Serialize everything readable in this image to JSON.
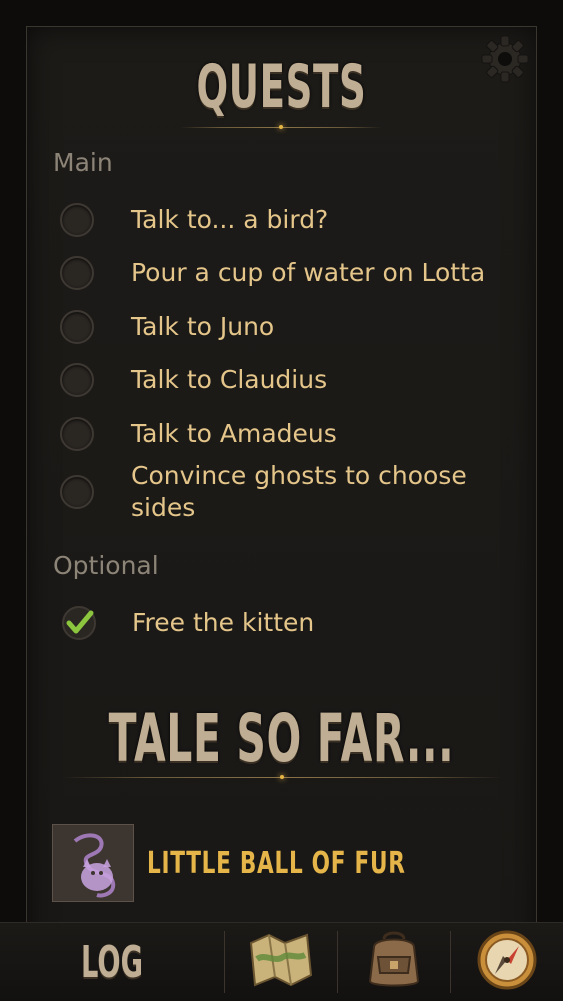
{
  "header": {
    "title": "QUESTS"
  },
  "sections": {
    "main_label": "Main",
    "optional_label": "Optional"
  },
  "main_quests": [
    {
      "label": "Talk to... a bird?",
      "completed": false
    },
    {
      "label": "Pour a cup of water on Lotta",
      "completed": false
    },
    {
      "label": "Talk to Juno",
      "completed": false
    },
    {
      "label": "Talk to Claudius",
      "completed": false
    },
    {
      "label": "Talk to Amadeus",
      "completed": false
    },
    {
      "label": "Convince ghosts to choose sides",
      "completed": false
    }
  ],
  "optional_quests": [
    {
      "label": "Free the kitten",
      "completed": true
    }
  ],
  "tale": {
    "title": "TALE SO FAR...",
    "entries": [
      {
        "title": "LITTLE BALL OF FUR"
      }
    ]
  },
  "navbar": {
    "log_label": "LOG",
    "items": [
      "log",
      "map-icon",
      "backpack-icon",
      "compass-icon"
    ]
  },
  "colors": {
    "quest_text": "#e4c58a",
    "heading": "#bfae93",
    "entry_title": "#e6b54a",
    "check_green": "#8cc63f"
  }
}
